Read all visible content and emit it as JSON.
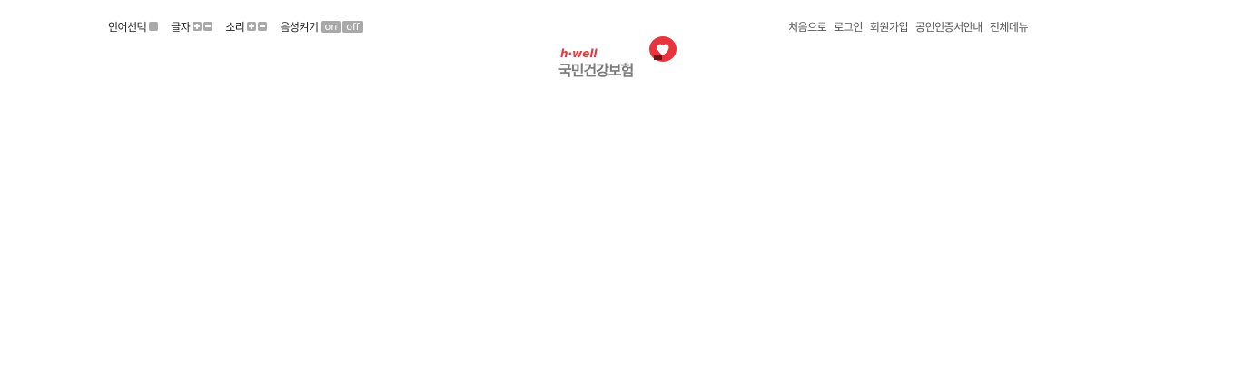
{
  "utility_left": {
    "language": {
      "label": "언어선택"
    },
    "font_size": {
      "label": "글자"
    },
    "sound": {
      "label": "소리"
    },
    "voice": {
      "label": "음성켜기",
      "on": "on",
      "off": "off"
    }
  },
  "logo": {
    "sub": "h·well",
    "name": "국민건강보험"
  },
  "utility_right": [
    {
      "label": "처음으로"
    },
    {
      "label": "로그인"
    },
    {
      "label": "회원가입"
    },
    {
      "label": "공인인증서안내"
    },
    {
      "label": "전체메뉴"
    }
  ],
  "colors": {
    "brand_red": "#e8343c",
    "button_gray": "#a9a9a9",
    "logo_gray": "#7a7a7a"
  },
  "icons": {
    "language": "square-button",
    "font_plus": "plus-icon",
    "font_minus": "minus-icon",
    "sound_plus": "plus-icon",
    "sound_minus": "minus-icon",
    "badge": "heart-speech-bubble-icon"
  }
}
